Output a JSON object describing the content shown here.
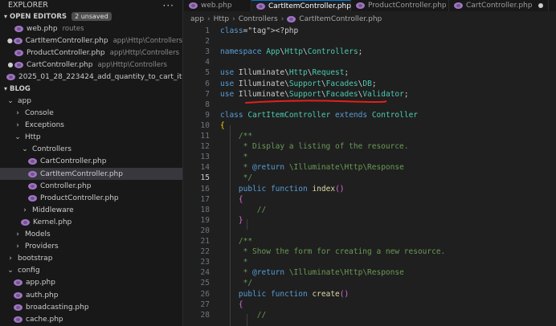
{
  "explorer": {
    "title": "EXPLORER",
    "more": "···",
    "open_editors": {
      "label": "OPEN EDITORS",
      "badge": "2 unsaved",
      "items": [
        {
          "name": "web.php",
          "path": "routes",
          "mark": "",
          "icon": "php-elephant-icon"
        },
        {
          "name": "CartItemController.php",
          "path": "app\\Http\\Controllers",
          "mark": "●",
          "icon": "php-elephant-icon"
        },
        {
          "name": "ProductController.php",
          "path": "app\\Http\\Controllers",
          "mark": "",
          "icon": "php-elephant-icon"
        },
        {
          "name": "CartController.php",
          "path": "app\\Http\\Controllers",
          "mark": "●",
          "icon": "php-elephant-icon"
        },
        {
          "name": "2025_01_28_223424_add_quantity_to_cart_it...",
          "path": "",
          "mark": "",
          "icon": "php-elephant-icon"
        }
      ]
    },
    "project": {
      "label": "BLOG",
      "tree": [
        {
          "label": "app",
          "depth": 1,
          "type": "folder-open"
        },
        {
          "label": "Console",
          "depth": 2,
          "type": "folder"
        },
        {
          "label": "Exceptions",
          "depth": 2,
          "type": "folder"
        },
        {
          "label": "Http",
          "depth": 2,
          "type": "folder-open"
        },
        {
          "label": "Controllers",
          "depth": 3,
          "type": "folder-open"
        },
        {
          "label": "CartController.php",
          "depth": 4,
          "type": "file"
        },
        {
          "label": "CartItemController.php",
          "depth": 4,
          "type": "file",
          "selected": true
        },
        {
          "label": "Controller.php",
          "depth": 4,
          "type": "file"
        },
        {
          "label": "ProductController.php",
          "depth": 4,
          "type": "file"
        },
        {
          "label": "Middleware",
          "depth": 3,
          "type": "folder"
        },
        {
          "label": "Kernel.php",
          "depth": 3,
          "type": "file"
        },
        {
          "label": "Models",
          "depth": 2,
          "type": "folder"
        },
        {
          "label": "Providers",
          "depth": 2,
          "type": "folder"
        },
        {
          "label": "bootstrap",
          "depth": 1,
          "type": "folder"
        },
        {
          "label": "config",
          "depth": 1,
          "type": "folder-open"
        },
        {
          "label": "app.php",
          "depth": 2,
          "type": "file"
        },
        {
          "label": "auth.php",
          "depth": 2,
          "type": "file"
        },
        {
          "label": "broadcasting.php",
          "depth": 2,
          "type": "file"
        },
        {
          "label": "cache.php",
          "depth": 2,
          "type": "file"
        }
      ]
    }
  },
  "tabs": [
    {
      "label": "web.php",
      "active": false,
      "dirty": false
    },
    {
      "label": "CartItemController.php",
      "active": true,
      "dirty": true
    },
    {
      "label": "ProductController.php",
      "active": false,
      "dirty": false
    },
    {
      "label": "CartController.php",
      "active": false,
      "dirty": true
    }
  ],
  "breadcrumb": [
    "app",
    "Http",
    "Controllers",
    "CartItemController.php"
  ],
  "editor": {
    "current_line": 15,
    "lines": [
      {
        "n": 1,
        "t": "<?php"
      },
      {
        "n": 2,
        "t": ""
      },
      {
        "n": 3,
        "t": "namespace App\\Http\\Controllers;"
      },
      {
        "n": 4,
        "t": ""
      },
      {
        "n": 5,
        "t": "use Illuminate\\Http\\Request;"
      },
      {
        "n": 6,
        "t": "use Illuminate\\Support\\Facades\\DB;"
      },
      {
        "n": 7,
        "t": "use Illuminate\\Support\\Facades\\Validator;"
      },
      {
        "n": 8,
        "t": ""
      },
      {
        "n": 9,
        "t": "class CartItemController extends Controller"
      },
      {
        "n": 10,
        "t": "{"
      },
      {
        "n": 11,
        "t": "    /**"
      },
      {
        "n": 12,
        "t": "     * Display a listing of the resource."
      },
      {
        "n": 13,
        "t": "     *"
      },
      {
        "n": 14,
        "t": "     * @return \\Illuminate\\Http\\Response"
      },
      {
        "n": 15,
        "t": "     */"
      },
      {
        "n": 16,
        "t": "    public function index()"
      },
      {
        "n": 17,
        "t": "    {"
      },
      {
        "n": 18,
        "t": "        //"
      },
      {
        "n": 19,
        "t": "    }"
      },
      {
        "n": 20,
        "t": ""
      },
      {
        "n": 21,
        "t": "    /**"
      },
      {
        "n": 22,
        "t": "     * Show the form for creating a new resource."
      },
      {
        "n": 23,
        "t": "     *"
      },
      {
        "n": 24,
        "t": "     * @return \\Illuminate\\Http\\Response"
      },
      {
        "n": 25,
        "t": "     */"
      },
      {
        "n": 26,
        "t": "    public function create()"
      },
      {
        "n": 27,
        "t": "    {"
      },
      {
        "n": 28,
        "t": "        //"
      }
    ]
  },
  "colors": {
    "annotation": "#e0201b",
    "accent": "#0078d4"
  }
}
